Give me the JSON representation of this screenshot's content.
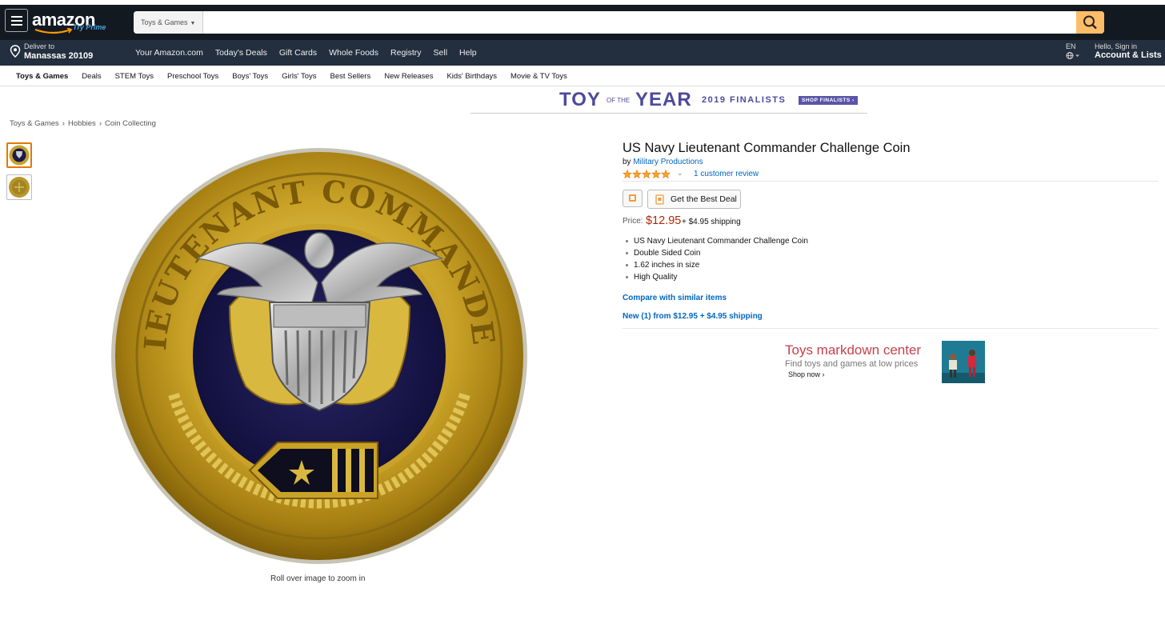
{
  "header": {
    "logo_text": "amazon",
    "logo_sub": "Try Prime",
    "search_category": "Toys & Games",
    "search_value": "",
    "deliver_line1": "Deliver to",
    "deliver_line2": "Manassas 20109",
    "nav_links": [
      "Your Amazon.com",
      "Today's Deals",
      "Gift Cards",
      "Whole Foods",
      "Registry",
      "Sell",
      "Help"
    ],
    "lang": "EN",
    "account_line1": "Hello, Sign in",
    "account_line2": "Account & Lists"
  },
  "subnav": {
    "items": [
      "Toys & Games",
      "Deals",
      "STEM Toys",
      "Preschool Toys",
      "Boys' Toys",
      "Girls' Toys",
      "Best Sellers",
      "New Releases",
      "Kids' Birthdays",
      "Movie & TV Toys"
    ]
  },
  "banner": {
    "toy": "TOY",
    "of_the": "OF THE",
    "year": "YEAR",
    "finalists": "2019 FINALISTS",
    "shop": "SHOP FINALISTS ›"
  },
  "breadcrumb": [
    "Toys & Games",
    "Hobbies",
    "Coin Collecting"
  ],
  "image": {
    "coin_text": "LIEUTENANT COMMANDER",
    "rollover_text": "Roll over image to zoom in"
  },
  "product": {
    "title": "US Navy Lieutenant Commander Challenge Coin",
    "by_prefix": "by",
    "brand": "Military Productions",
    "rating": 5,
    "reviews": "1 customer review",
    "deal_button": "Get the Best Deal",
    "price_label": "Price:",
    "price": "$12.95",
    "shipping": "+ $4.95 shipping",
    "bullets": [
      "US Navy Lieutenant Commander Challenge Coin",
      "Double Sided Coin",
      "1.62 inches in size",
      "High Quality"
    ],
    "compare_link": "Compare with similar items",
    "new_from": "New (1) from $12.95 + $4.95 shipping"
  },
  "ad": {
    "title": "Toys markdown center",
    "subtitle": "Find toys and games at low prices",
    "cta": "Shop now ›"
  },
  "colors": {
    "nav_dark": "#131921",
    "nav_secondary": "#232f3e",
    "search_button": "#febd69",
    "link": "#0066c0",
    "price": "#b12704",
    "banner_purple": "#4d4a9b"
  }
}
